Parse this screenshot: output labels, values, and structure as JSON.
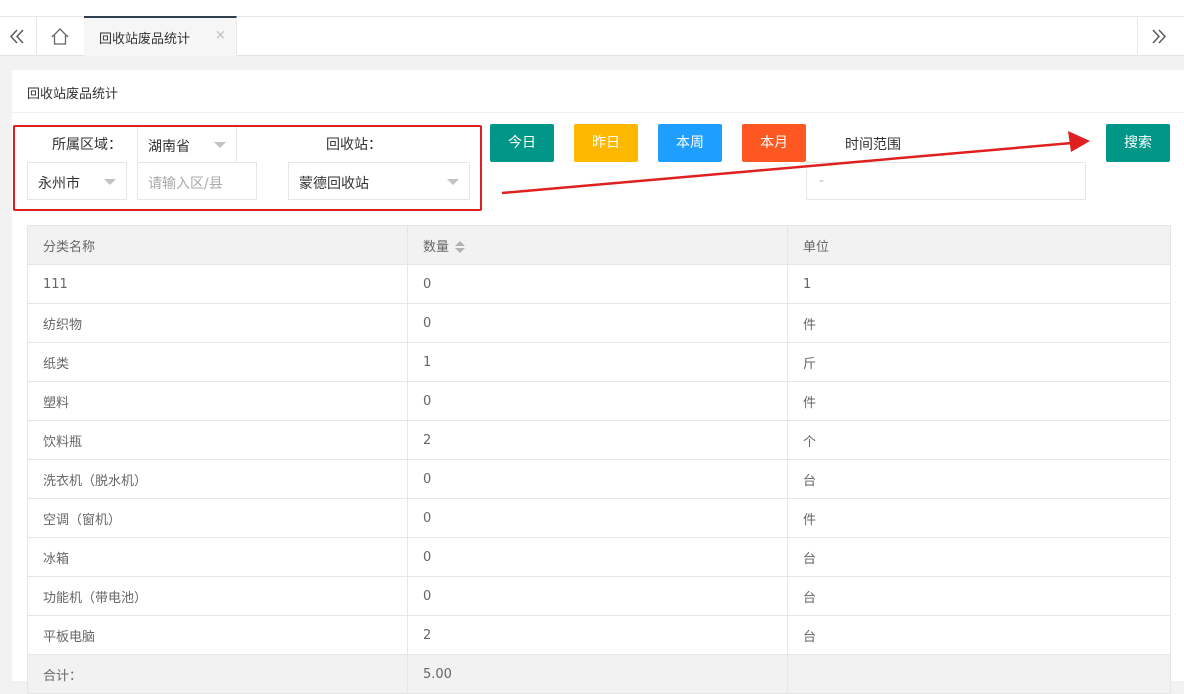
{
  "tabbar": {
    "active_tab": "回收站废品统计",
    "close": "×",
    "left_icon": "«",
    "right_icon": "»"
  },
  "panel": {
    "title": "回收站废品统计"
  },
  "filters": {
    "region_label": "所属区域：",
    "province": "湖南省",
    "city": "永州市",
    "district_placeholder": "请输入区/县",
    "station_label": "回收站：",
    "station": "蒙德回收站",
    "time_label": "时间范围",
    "time_value": "-"
  },
  "buttons": {
    "today": "今日",
    "yesterday": "昨日",
    "week": "本周",
    "month": "本月",
    "search": "搜索"
  },
  "colors": {
    "today": "#009688",
    "yesterday": "#ffb800",
    "week": "#1e9fff",
    "month": "#ff5722",
    "search": "#009688",
    "annotation": "#e02020"
  },
  "table": {
    "headers": [
      "分类名称",
      "数量",
      "单位"
    ],
    "rows": [
      [
        "111",
        "0",
        "1"
      ],
      [
        "纺织物",
        "0",
        "件"
      ],
      [
        "纸类",
        "1",
        "斤"
      ],
      [
        "塑料",
        "0",
        "件"
      ],
      [
        "饮料瓶",
        "2",
        "个"
      ],
      [
        "洗衣机（脱水机）",
        "0",
        "台"
      ],
      [
        "空调（窗机）",
        "0",
        "件"
      ],
      [
        "冰箱",
        "0",
        "台"
      ],
      [
        "功能机（带电池）",
        "0",
        "台"
      ],
      [
        "平板电脑",
        "2",
        "台"
      ]
    ],
    "footer": [
      "合计：",
      "5.00",
      ""
    ]
  }
}
